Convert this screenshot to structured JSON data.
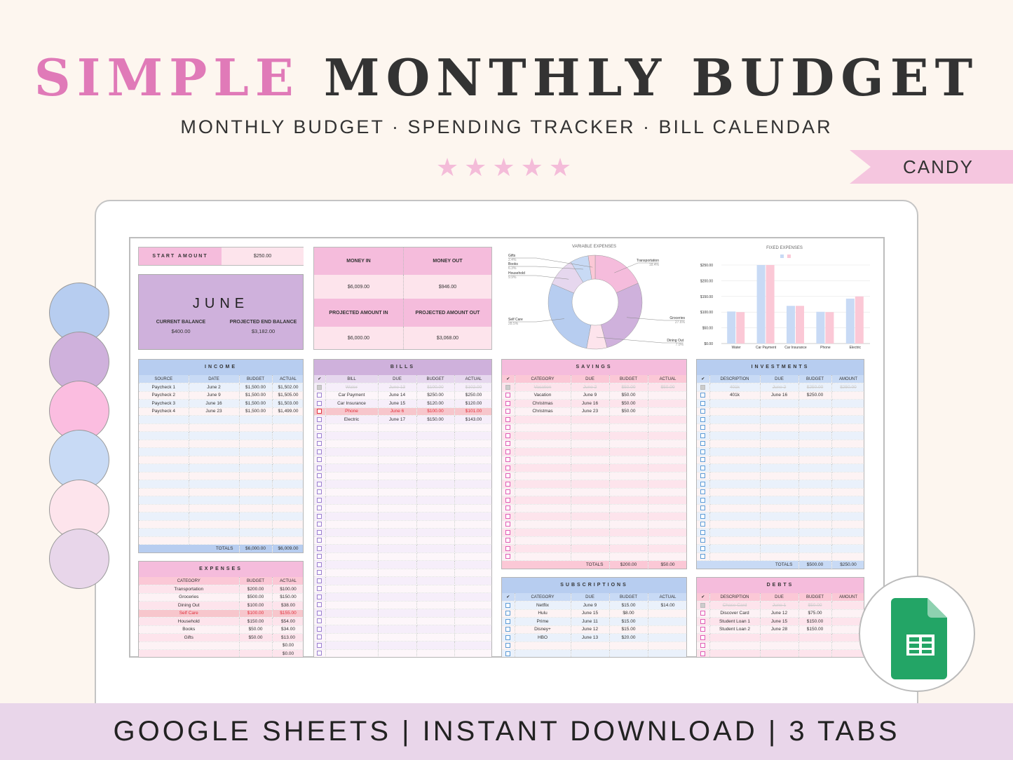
{
  "hero": {
    "title_accent": "SIMPLE",
    "title_rest": "MONTHLY BUDGET",
    "subtitle": "MONTHLY BUDGET  ·  SPENDING TRACKER  ·  BILL CALENDAR",
    "stars": 5,
    "stars_text": "★★★★★",
    "ribbon": "CANDY",
    "footer": "GOOGLE SHEETS | INSTANT DOWNLOAD | 3 TABS"
  },
  "swatches": [
    "#b7cdf0",
    "#cfb1dc",
    "#fbbde0",
    "#c8daf5",
    "#fde4ec",
    "#e8d6ea"
  ],
  "colors": {
    "pink": "#f5bcdc",
    "lavender": "#cfb1dc",
    "blue": "#b7cdf0",
    "light_pink": "#fde4ec",
    "accent_title": "#e07ab8",
    "overdue": "#e0303c",
    "sheets_green": "#23a566"
  },
  "summary": {
    "start_label": "START AMOUNT",
    "start_value": "$250.00",
    "month": "JUNE",
    "current_balance_label": "CURRENT BALANCE",
    "current_balance": "$400.00",
    "projected_end_label": "PROJECTED END BALANCE",
    "projected_end": "$3,182.00",
    "money_in_label": "MONEY IN",
    "money_in": "$6,009.00",
    "money_out_label": "MONEY OUT",
    "money_out": "$946.00",
    "proj_in_label": "PROJECTED AMOUNT IN",
    "proj_in": "$6,000.00",
    "proj_out_label": "PROJECTED AMOUNT OUT",
    "proj_out": "$3,068.00"
  },
  "chart_data": [
    {
      "type": "pie",
      "title": "VARIABLE EXPENSES",
      "donut": true,
      "categories": [
        "Transportation",
        "Groceries",
        "Dining Out",
        "Self Care",
        "Household",
        "Books",
        "Gifts"
      ],
      "values": [
        18.4,
        27.6,
        7.0,
        28.5,
        9.9,
        6.3,
        2.4
      ],
      "labels": [
        "18.4%",
        "27.6%",
        "7.0%",
        "28.5%",
        "9.9%",
        "6.3%",
        "2.4%"
      ],
      "colors": [
        "#f5bcdc",
        "#cfb1dc",
        "#fde4ec",
        "#b7cdf0",
        "#e6d7ee",
        "#c8daf5",
        "#fbc8d6"
      ]
    },
    {
      "type": "bar",
      "title": "FIXED EXPENSES",
      "categories": [
        "Water",
        "Car Payment",
        "Car Insurance",
        "Phone",
        "Electric"
      ],
      "series": [
        {
          "values": [
            102,
            250,
            120,
            101,
            143
          ],
          "color": "#c8daf5"
        },
        {
          "values": [
            100,
            250,
            120,
            100,
            150
          ],
          "color": "#fbc8d6"
        }
      ],
      "ylim": [
        0,
        250
      ],
      "yticks": [
        "$0.00",
        "$50.00",
        "$100.00",
        "$150.00",
        "$200.00",
        "$250.00"
      ],
      "grid": true,
      "legend": "top"
    }
  ],
  "tables": {
    "income": {
      "title": "INCOME",
      "headers": [
        "SOURCE",
        "DATE",
        "BUDGET",
        "ACTUAL"
      ],
      "rows": [
        [
          "Paycheck 1",
          "June 2",
          "$1,500.00",
          "$1,502.00"
        ],
        [
          "Paycheck 2",
          "June 9",
          "$1,500.00",
          "$1,505.00"
        ],
        [
          "Paycheck 3",
          "June 16",
          "$1,500.00",
          "$1,503.00"
        ],
        [
          "Paycheck 4",
          "June 23",
          "$1,500.00",
          "$1,499.00"
        ]
      ],
      "totals_label": "TOTALS",
      "totals": [
        "$6,000.00",
        "$6,009.00"
      ]
    },
    "bills": {
      "title": "BILLS",
      "headers": [
        "✔",
        "BILL",
        "DUE",
        "BUDGET",
        "ACTUAL"
      ],
      "rows": [
        {
          "checked": true,
          "cells": [
            "Water",
            "June 13",
            "$100.00",
            "$102.00"
          ]
        },
        {
          "checked": false,
          "cells": [
            "Car Payment",
            "June 14",
            "$250.00",
            "$250.00"
          ]
        },
        {
          "checked": false,
          "cells": [
            "Car Insurance",
            "June 15",
            "$120.00",
            "$120.00"
          ]
        },
        {
          "checked": false,
          "overdue": true,
          "cells": [
            "Phone",
            "June 6",
            "$100.00",
            "$101.00"
          ]
        },
        {
          "checked": false,
          "cells": [
            "Electric",
            "June 17",
            "$150.00",
            "$143.00"
          ]
        }
      ]
    },
    "savings": {
      "title": "SAVINGS",
      "headers": [
        "✔",
        "CATEGORY",
        "DUE",
        "BUDGET",
        "ACTUAL"
      ],
      "rows": [
        {
          "checked": true,
          "cells": [
            "Vacation",
            "June 2",
            "$50.00",
            "$50.00"
          ]
        },
        {
          "checked": false,
          "cells": [
            "Vacation",
            "June 9",
            "$50.00",
            ""
          ]
        },
        {
          "checked": false,
          "cells": [
            "Christmas",
            "June 16",
            "$50.00",
            ""
          ]
        },
        {
          "checked": false,
          "cells": [
            "Christmas",
            "June 23",
            "$50.00",
            ""
          ]
        }
      ],
      "totals_label": "TOTALS",
      "totals": [
        "$200.00",
        "$50.00"
      ]
    },
    "investments": {
      "title": "INVESTMENTS",
      "headers": [
        "✔",
        "DESCRIPTION",
        "DUE",
        "BUDGET",
        "AMOUNT"
      ],
      "rows": [
        {
          "checked": true,
          "cells": [
            "401k",
            "June 2",
            "$250.00",
            "$250.00"
          ]
        },
        {
          "checked": false,
          "cells": [
            "401k",
            "June 16",
            "$250.00",
            ""
          ]
        }
      ],
      "totals_label": "TOTALS",
      "totals": [
        "$500.00",
        "$250.00"
      ]
    },
    "expenses": {
      "title": "EXPENSES",
      "headers": [
        "CATEGORY",
        "BUDGET",
        "ACTUAL"
      ],
      "rows": [
        {
          "cells": [
            "Transportation",
            "$200.00",
            "$100.00"
          ]
        },
        {
          "cells": [
            "Groceries",
            "$500.00",
            "$150.00"
          ]
        },
        {
          "cells": [
            "Dining Out",
            "$100.00",
            "$38.00"
          ]
        },
        {
          "overdue": true,
          "cells": [
            "Self Care",
            "$100.00",
            "$155.00"
          ]
        },
        {
          "cells": [
            "Household",
            "$150.00",
            "$54.00"
          ]
        },
        {
          "cells": [
            "Books",
            "$50.00",
            "$34.00"
          ]
        },
        {
          "cells": [
            "Gifts",
            "$50.00",
            "$13.00"
          ]
        },
        {
          "cells": [
            "",
            "",
            "$0.00"
          ]
        },
        {
          "cells": [
            "",
            "",
            "$0.00"
          ]
        }
      ]
    },
    "subscriptions": {
      "title": "SUBSCRIPTIONS",
      "headers": [
        "✔",
        "CATEGORY",
        "DUE",
        "BUDGET",
        "ACTUAL"
      ],
      "rows": [
        {
          "checked": false,
          "cells": [
            "Netflix",
            "June 9",
            "$15.00",
            "$14.00"
          ]
        },
        {
          "checked": false,
          "cells": [
            "Hulu",
            "June 15",
            "$8.00",
            ""
          ]
        },
        {
          "checked": false,
          "cells": [
            "Prime",
            "June 11",
            "$15.00",
            ""
          ]
        },
        {
          "checked": false,
          "cells": [
            "Disney+",
            "June 12",
            "$15.00",
            ""
          ]
        },
        {
          "checked": false,
          "cells": [
            "HBO",
            "June 13",
            "$20.00",
            ""
          ]
        }
      ]
    },
    "debts": {
      "title": "DEBTS",
      "headers": [
        "✔",
        "DESCRIPTION",
        "DUE",
        "BUDGET",
        "AMOUNT"
      ],
      "rows": [
        {
          "checked": true,
          "cells": [
            "Chase Card",
            "June 1",
            "$50.00",
            ""
          ]
        },
        {
          "checked": false,
          "cells": [
            "Discover Card",
            "June 12",
            "$75.00",
            ""
          ]
        },
        {
          "checked": false,
          "cells": [
            "Student Loan 1",
            "June 15",
            "$150.00",
            ""
          ]
        },
        {
          "checked": false,
          "cells": [
            "Student Loan 2",
            "June 28",
            "$150.00",
            ""
          ]
        }
      ]
    }
  }
}
